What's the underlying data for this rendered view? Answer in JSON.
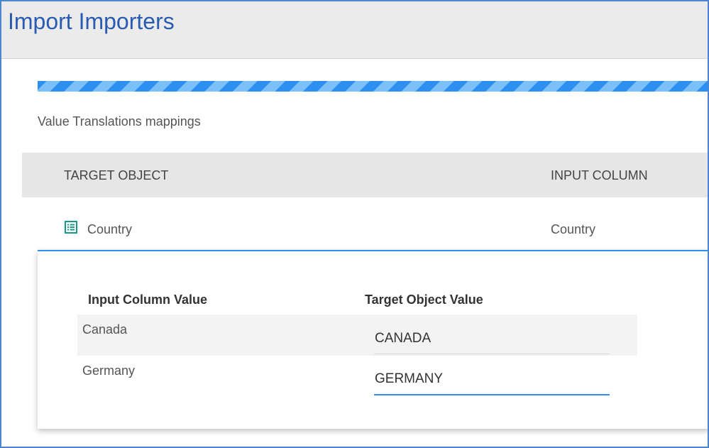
{
  "window": {
    "title": "Import Importers"
  },
  "progress": {
    "state": "indeterminate",
    "color": "#2d8ff0"
  },
  "section": {
    "label": "Value Translations mappings"
  },
  "table": {
    "headers": {
      "target_object": "TARGET OBJECT",
      "input_column": "INPUT COLUMN"
    },
    "rows": [
      {
        "target_object": "Country",
        "input_column": "Country",
        "icon": "list-icon"
      }
    ]
  },
  "mapping_panel": {
    "headers": {
      "input_column_value": "Input Column Value",
      "target_object_value": "Target Object Value"
    },
    "rows": [
      {
        "input_value": "Canada",
        "target_value": "CANADA"
      },
      {
        "input_value": "Germany",
        "target_value": "GERMANY"
      }
    ]
  },
  "colors": {
    "title": "#2a5bb0",
    "accent": "#2d8ff0",
    "icon": "#1a9a8a"
  }
}
